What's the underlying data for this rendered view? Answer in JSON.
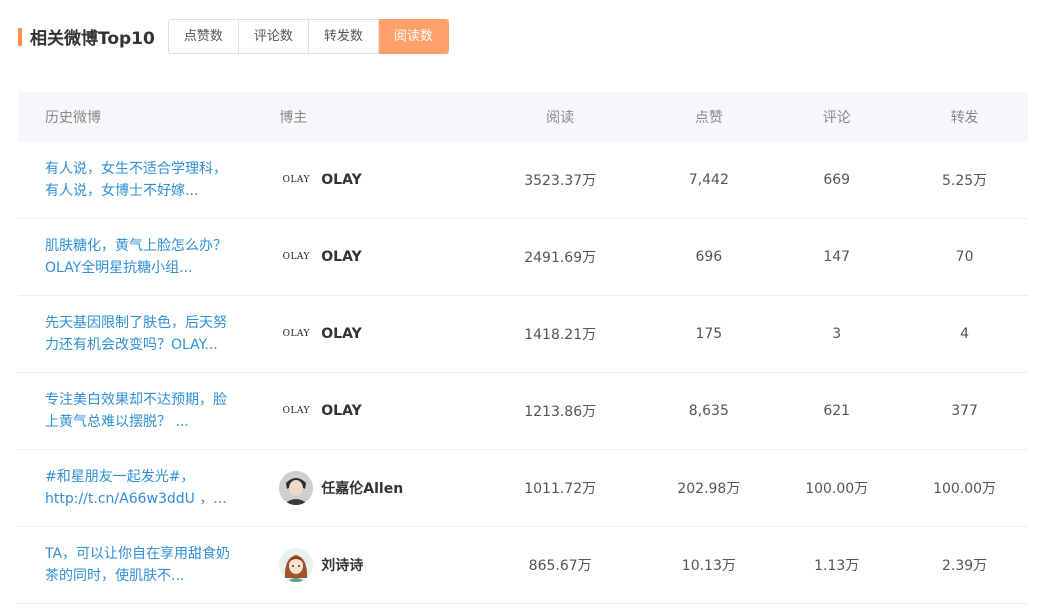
{
  "header": {
    "title": "相关微博Top10",
    "accent_color": "#ff9150",
    "tabs": [
      {
        "label": "点赞数",
        "active": false
      },
      {
        "label": "评论数",
        "active": false
      },
      {
        "label": "转发数",
        "active": false
      },
      {
        "label": "阅读数",
        "active": true
      }
    ]
  },
  "table": {
    "columns": [
      "历史微博",
      "博主",
      "阅读",
      "点赞",
      "评论",
      "转发"
    ],
    "rows": [
      {
        "post": "有人说，女生不适合学理科， 有人说，女博士不好嫁...",
        "blogger": "OLAY",
        "avatar": "olay-logo-icon",
        "avatar_text": "OLAY",
        "reads": "3523.37万",
        "likes": "7,442",
        "comments": "669",
        "reposts": "5.25万"
      },
      {
        "post": "肌肤糖化，黄气上脸怎么办？ OLAY全明星抗糖小组...",
        "blogger": "OLAY",
        "avatar": "olay-logo-icon",
        "avatar_text": "OLAY",
        "reads": "2491.69万",
        "likes": "696",
        "comments": "147",
        "reposts": "70"
      },
      {
        "post": "先天基因限制了肤色，后天努力还有机会改变吗？OLAY...",
        "blogger": "OLAY",
        "avatar": "olay-logo-icon",
        "avatar_text": "OLAY",
        "reads": "1418.21万",
        "likes": "175",
        "comments": "3",
        "reposts": "4"
      },
      {
        "post": "专注美白效果却不达预期，脸上黄气总难以摆脱？ ...",
        "blogger": "OLAY",
        "avatar": "olay-logo-icon",
        "avatar_text": "OLAY",
        "reads": "1213.86万",
        "likes": "8,635",
        "comments": "621",
        "reposts": "377"
      },
      {
        "post": "#和星朋友一起发光#，http://t.cn/A66w3ddU ，...",
        "blogger": "任嘉伦Allen",
        "avatar": "person-avatar-icon",
        "avatar_text": "",
        "reads": "1011.72万",
        "likes": "202.98万",
        "comments": "100.00万",
        "reposts": "100.00万"
      },
      {
        "post": "TA，可以让你自在享用甜食奶茶的同时，使肌肤不...",
        "blogger": "刘诗诗",
        "avatar": "cartoon-avatar-icon",
        "avatar_text": "",
        "reads": "865.67万",
        "likes": "10.13万",
        "comments": "1.13万",
        "reposts": "2.39万"
      }
    ]
  }
}
